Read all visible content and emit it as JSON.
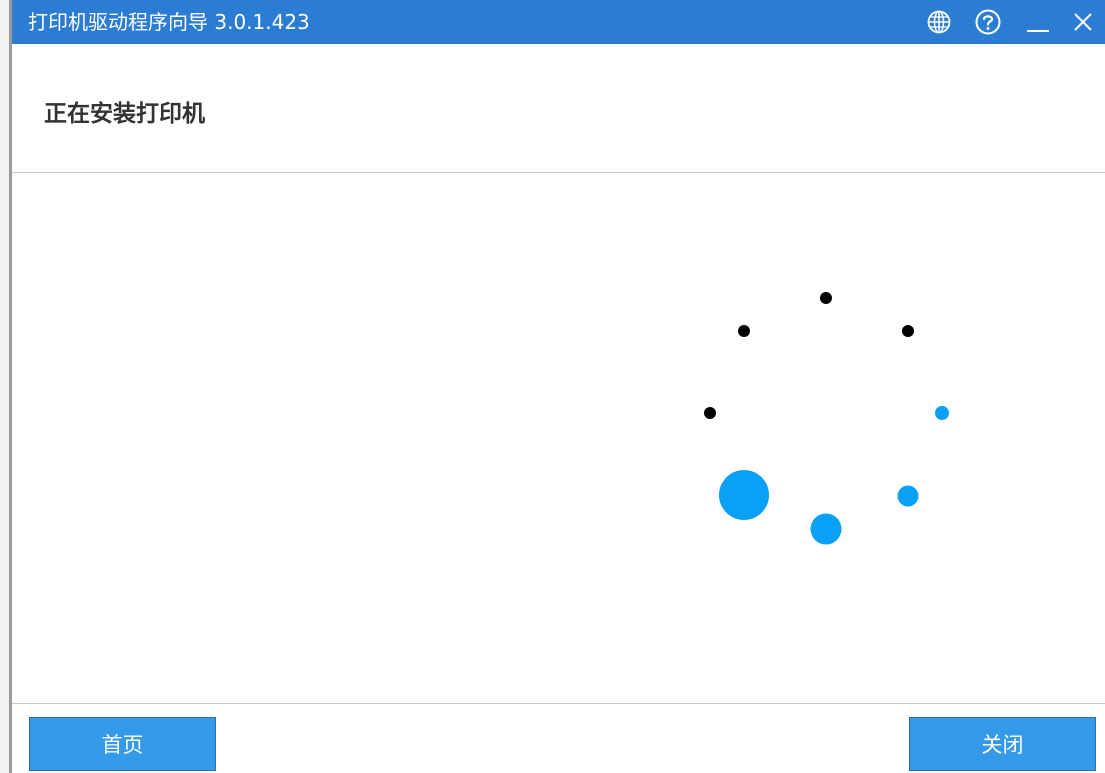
{
  "window": {
    "title": "打印机驱动程序向导  3.0.1.423",
    "accent_color": "#2b7cd3",
    "controls": {
      "language_icon": "globe-icon",
      "help_icon": "help-icon",
      "minimize_icon": "minimize-icon",
      "close_icon": "close-icon"
    }
  },
  "header": {
    "title": "正在安装打印机"
  },
  "spinner": {
    "active_color": "#0aa0f5",
    "inactive_color": "#000000"
  },
  "footer": {
    "home_label": "首页",
    "close_label": "关闭",
    "button_color": "#3399e8"
  }
}
